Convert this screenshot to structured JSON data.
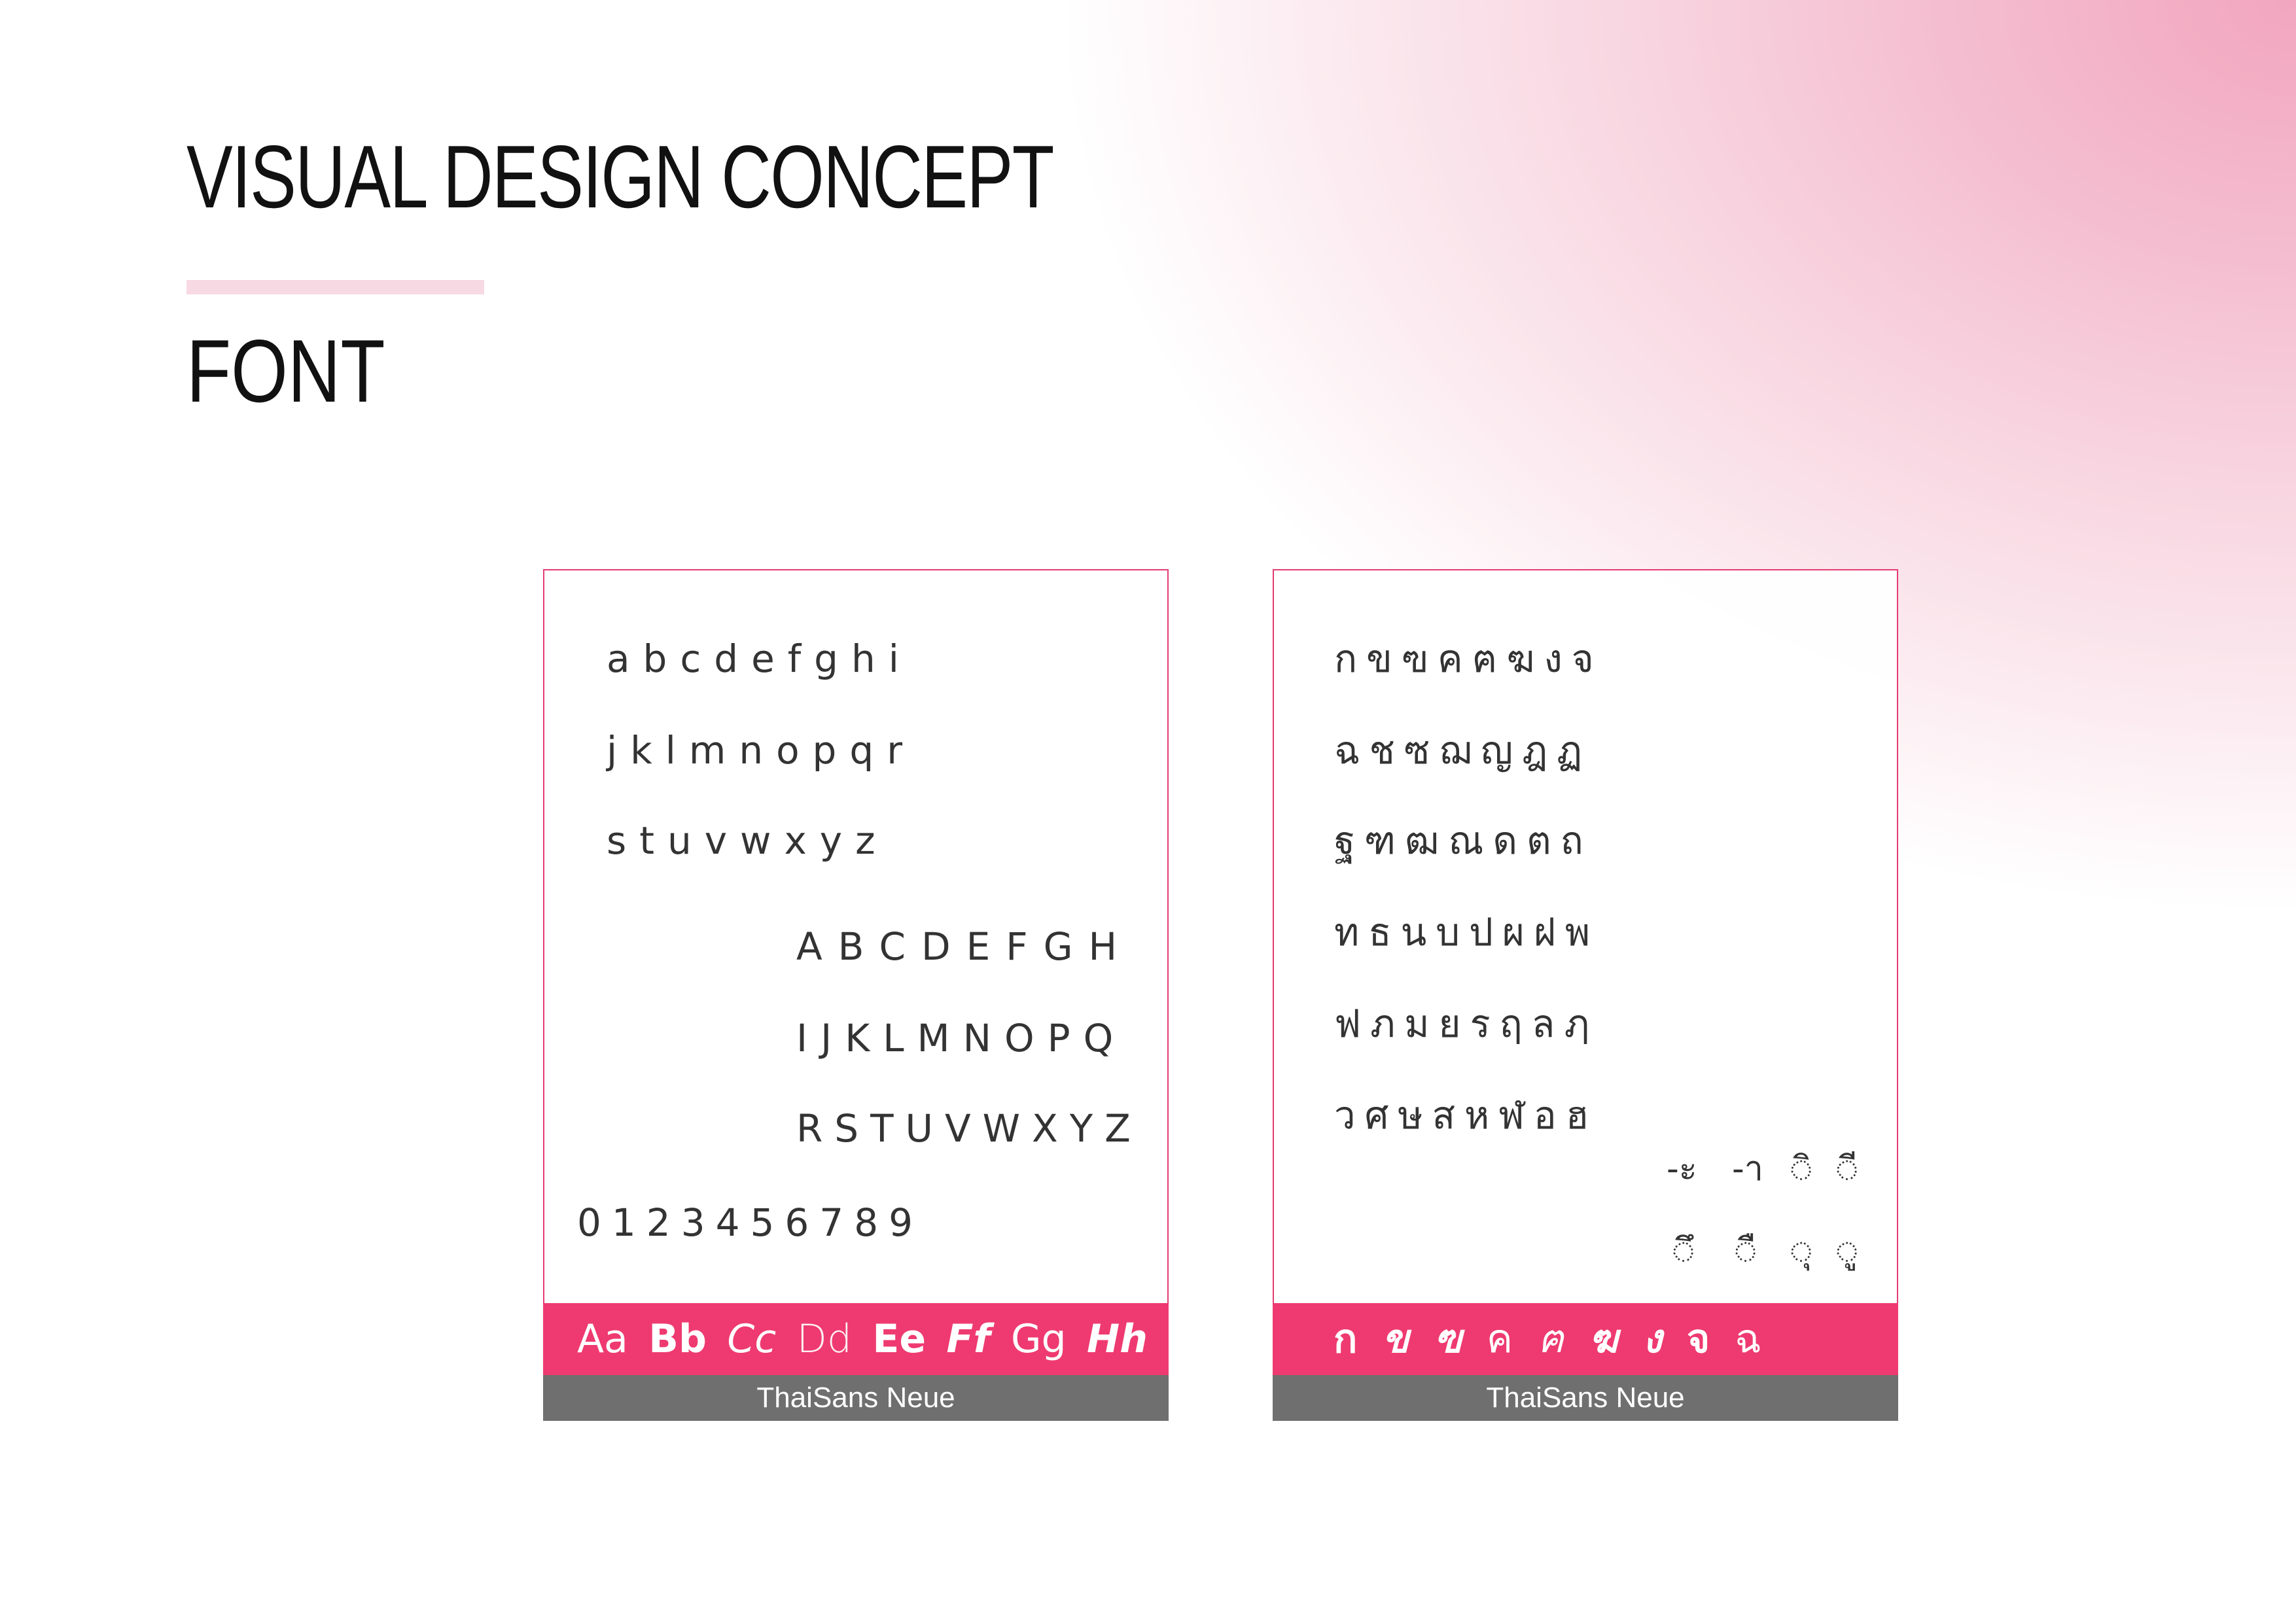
{
  "header": {
    "title": "VISUAL DESIGN CONCEPT",
    "subtitle": "FONT"
  },
  "colors": {
    "accent": "#ee3a70",
    "border": "#e43c72",
    "caption_bg": "#6f6f6f",
    "divider": "#f7d9e3"
  },
  "latin_card": {
    "rows": [
      "abcdefghi",
      "jklmnopqr",
      "stuvwxyz",
      "ABCDEFGH",
      "IJKLMNOPQ",
      "RSTUVWXYZ",
      "0123456789"
    ],
    "samples": [
      "Aa",
      "Bb",
      "Cc",
      "Dd",
      "Ee",
      "Ff",
      "Gg",
      "Hh"
    ],
    "font_name": "ThaiSans Neue"
  },
  "thai_card": {
    "rows": [
      "กขฃคฅฆงจ",
      "ฉชซฌญฎฏ",
      "ฐฑฒณดตถ",
      "ทธนบปผฝพ",
      "ฟภมยรฤลฦ",
      "วศษสหฬอฮ"
    ],
    "vowels": [
      "-ะ",
      "-า",
      "◌ิ",
      "◌ี",
      "◌ึ",
      "◌ื",
      "◌ุ",
      "◌ู"
    ],
    "samples": [
      "ก",
      "ข",
      "ฃ",
      "ค",
      "ฅ",
      "ฆ",
      "ง",
      "จ",
      "ฉ"
    ],
    "font_name": "ThaiSans Neue"
  }
}
